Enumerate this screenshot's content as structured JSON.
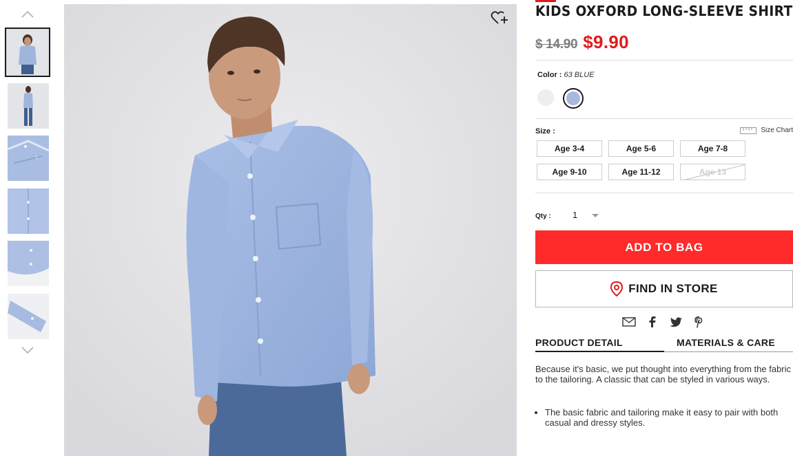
{
  "product": {
    "title": "KIDS OXFORD LONG-SLEEVE SHIRT",
    "old_price": "$ 14.90",
    "new_price": "$9.90"
  },
  "color": {
    "label": "Color :",
    "selected": "63 BLUE",
    "swatches": [
      "#eeeeee",
      "#a9b9de"
    ]
  },
  "size": {
    "label": "Size :",
    "chart_label": "Size Chart",
    "options": [
      {
        "label": "Age 3-4",
        "available": true
      },
      {
        "label": "Age 5-6",
        "available": true
      },
      {
        "label": "Age 7-8",
        "available": true
      },
      {
        "label": "Age 9-10",
        "available": true
      },
      {
        "label": "Age 11-12",
        "available": true
      },
      {
        "label": "Age 13",
        "available": false
      }
    ]
  },
  "qty": {
    "label": "Qty :",
    "value": "1"
  },
  "buttons": {
    "add_to_bag": "ADD TO BAG",
    "find_in_store": "FIND IN STORE"
  },
  "share": [
    "email-icon",
    "facebook-icon",
    "twitter-icon",
    "pinterest-icon"
  ],
  "tabs": {
    "product_detail": "PRODUCT DETAIL",
    "materials_care": "MATERIALS & CARE"
  },
  "description": {
    "text": "Because it's basic, we put thought into everything from the fabric to the tailoring. A classic that can be styled in various ways.",
    "bullets": [
      "The basic fabric and tailoring make it easy to pair with both casual and dressy styles."
    ]
  },
  "colors": {
    "accent_red": "#ff2a2a",
    "price_red": "#e01b1b"
  }
}
